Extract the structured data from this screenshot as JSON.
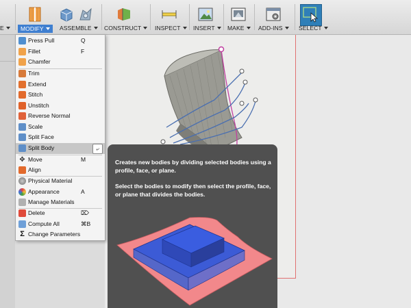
{
  "toolbar": {
    "groups": [
      {
        "label": "MODIFY",
        "active": true
      },
      {
        "label": "ASSEMBLE"
      },
      {
        "label": "CONSTRUCT"
      },
      {
        "label": "INSPECT"
      },
      {
        "label": "INSERT"
      },
      {
        "label": "MAKE"
      },
      {
        "label": "ADD-INS"
      },
      {
        "label": "SELECT"
      }
    ]
  },
  "menu": {
    "items": [
      {
        "label": "Press Pull",
        "shortcut": "Q",
        "icon": "press-pull-icon"
      },
      {
        "label": "Fillet",
        "shortcut": "F",
        "icon": "fillet-icon"
      },
      {
        "label": "Chamfer",
        "shortcut": "",
        "icon": "chamfer-icon"
      },
      {
        "label": "Trim",
        "shortcut": "",
        "icon": "trim-icon"
      },
      {
        "label": "Extend",
        "shortcut": "",
        "icon": "extend-icon"
      },
      {
        "label": "Stitch",
        "shortcut": "",
        "icon": "stitch-icon"
      },
      {
        "label": "Unstitch",
        "shortcut": "",
        "icon": "unstitch-icon"
      },
      {
        "label": "Reverse Normal",
        "shortcut": "",
        "icon": "reverse-normal-icon"
      },
      {
        "label": "Scale",
        "shortcut": "",
        "icon": "scale-icon"
      },
      {
        "label": "Split Face",
        "shortcut": "",
        "icon": "split-face-icon"
      },
      {
        "label": "Split Body",
        "shortcut": "",
        "icon": "split-body-icon",
        "highlighted": true
      },
      {
        "label": "Move",
        "shortcut": "M",
        "icon": "move-icon"
      },
      {
        "label": "Align",
        "shortcut": "",
        "icon": "align-icon"
      },
      {
        "label": "Physical Material",
        "shortcut": "",
        "icon": "physical-material-icon"
      },
      {
        "label": "Appearance",
        "shortcut": "A",
        "icon": "appearance-icon"
      },
      {
        "label": "Manage Materials",
        "shortcut": "",
        "icon": "manage-materials-icon"
      },
      {
        "label": "Delete",
        "shortcut": "⌦",
        "icon": "delete-icon"
      },
      {
        "label": "Compute All",
        "shortcut": "⌘B",
        "icon": "compute-all-icon"
      },
      {
        "label": "Change Parameters",
        "shortcut": "",
        "icon": "change-parameters-icon"
      }
    ]
  },
  "tooltip": {
    "description": "Creates new bodies by dividing selected bodies using a profile, face, or plane.",
    "instruction": "Select the bodies to modify then select the profile, face, or plane that divides the bodies."
  },
  "colors": {
    "accent": "#3f7fd0",
    "select_bg": "#2f7fb8",
    "tooltip_bg": "#505050",
    "highlight": "#c7c7c7"
  }
}
